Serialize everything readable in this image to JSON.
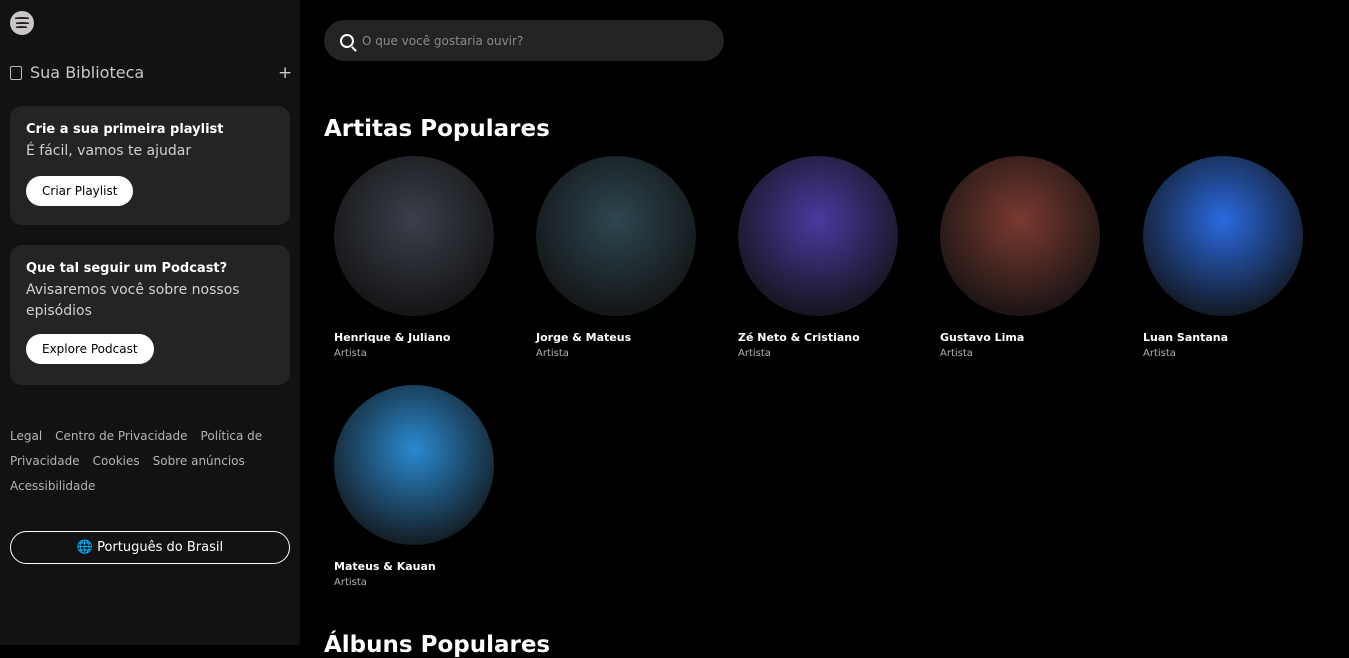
{
  "sidebar": {
    "library_title": "Sua Biblioteca",
    "add_label": "+",
    "playlist_card": {
      "title": "Crie a sua primeira playlist",
      "text": "É fácil, vamos te ajudar",
      "button": "Criar Playlist"
    },
    "podcast_card": {
      "title": "Que tal seguir um Podcast?",
      "text": "Avisaremos você sobre nossos episódios",
      "button": "Explore Podcast"
    },
    "links": [
      "Legal",
      "Centro de Privacidade",
      "Política de Privacidade",
      "Cookies",
      "Sobre anúncios",
      "Acessibilidade"
    ],
    "language": "Português do Brasil"
  },
  "search": {
    "placeholder": "O que você gostaria ouvir?"
  },
  "sections": {
    "popular_artists": "Artitas Populares",
    "popular_albums": "Álbuns Populares"
  },
  "artists": [
    {
      "name": "Henrique & Juliano",
      "role": "Artista",
      "color": "#3a3f4a"
    },
    {
      "name": "Jorge & Mateus",
      "role": "Artista",
      "color": "#2d4650"
    },
    {
      "name": "Zé Neto & Cristiano",
      "role": "Artista",
      "color": "#4a3aa0"
    },
    {
      "name": "Gustavo Lima",
      "role": "Artista",
      "color": "#7a3a30"
    },
    {
      "name": "Luan Santana",
      "role": "Artista",
      "color": "#2a6ae0"
    },
    {
      "name": "Mateus & Kauan",
      "role": "Artista",
      "color": "#2a8ad0"
    }
  ]
}
